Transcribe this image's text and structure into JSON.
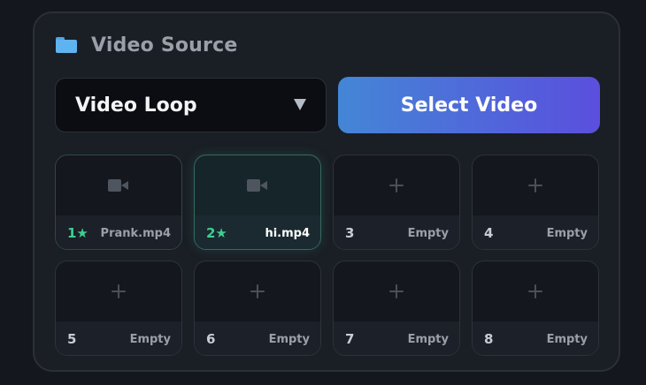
{
  "section": {
    "title": "Video Source",
    "icon": "folder-icon"
  },
  "source_select": {
    "value": "Video Loop"
  },
  "select_button": {
    "label": "Select Video"
  },
  "colors": {
    "accent_green": "#3ecf8e",
    "button_gradient_start": "#4486d6",
    "button_gradient_end": "#5a4fdd"
  },
  "slots": [
    {
      "number": "1★",
      "name": "Prank.mp4",
      "state": "filled",
      "icon": "video-camera-icon"
    },
    {
      "number": "2★",
      "name": "hi.mp4",
      "state": "active",
      "icon": "video-camera-icon"
    },
    {
      "number": "3",
      "name": "Empty",
      "state": "empty",
      "icon": "plus-icon"
    },
    {
      "number": "4",
      "name": "Empty",
      "state": "empty",
      "icon": "plus-icon"
    },
    {
      "number": "5",
      "name": "Empty",
      "state": "empty",
      "icon": "plus-icon"
    },
    {
      "number": "6",
      "name": "Empty",
      "state": "empty",
      "icon": "plus-icon"
    },
    {
      "number": "7",
      "name": "Empty",
      "state": "empty",
      "icon": "plus-icon"
    },
    {
      "number": "8",
      "name": "Empty",
      "state": "empty",
      "icon": "plus-icon"
    }
  ]
}
